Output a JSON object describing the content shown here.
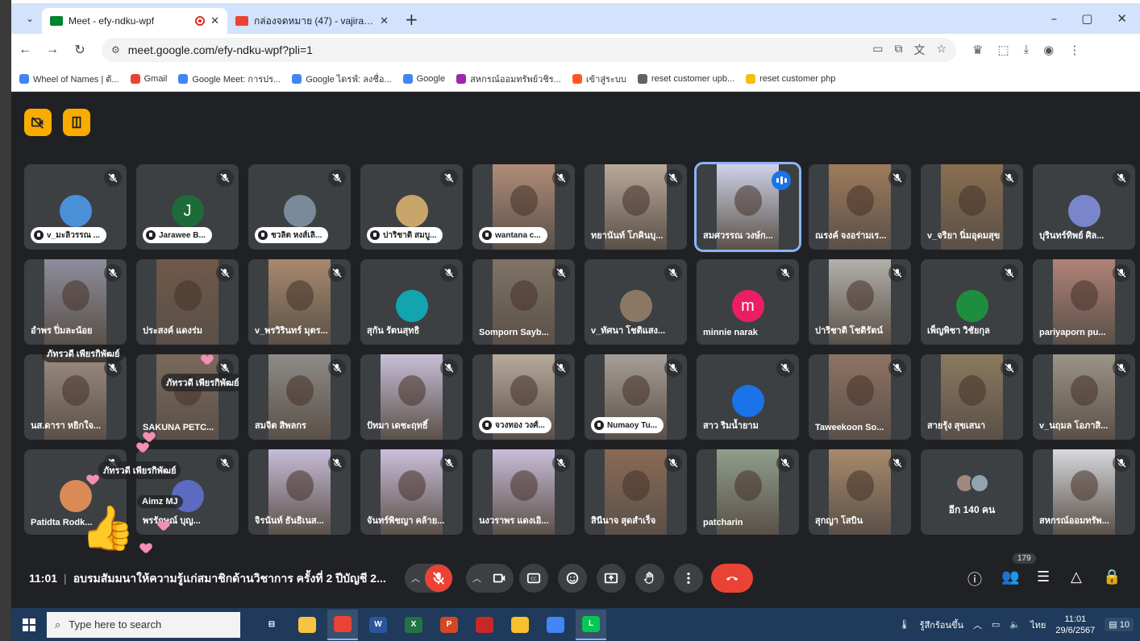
{
  "browser": {
    "tabs": [
      {
        "title": "Meet - efy-ndku-wpf",
        "favicon_color": "#00832d",
        "active": true
      },
      {
        "title": "กล่องจดหมาย (47) - vajiracoop@",
        "favicon_color": "#ea4335",
        "active": false
      }
    ],
    "url": "meet.google.com/efy-ndku-wpf?pli=1",
    "bookmarks": [
      {
        "label": "Wheel of Names | ตั...",
        "color": "#4285f4"
      },
      {
        "label": "Gmail",
        "color": "#ea4335"
      },
      {
        "label": "Google Meet: การปร...",
        "color": "#4285f4"
      },
      {
        "label": "Google ไดรฟ์: ลงชื่อ...",
        "color": "#4285f4"
      },
      {
        "label": "Google",
        "color": "#4285f4"
      },
      {
        "label": "สหกรณ์ออมทรัพย์วชิร...",
        "color": "#9c27b0"
      },
      {
        "label": "เข้าสู่ระบบ",
        "color": "#ff5722"
      },
      {
        "label": "reset customer upb...",
        "color": "#5f6368"
      },
      {
        "label": "reset customer php",
        "color": "#fbbc04"
      }
    ]
  },
  "participants": [
    {
      "name": "v_มะลิวรรณ ...",
      "kind": "avatar",
      "color": "#4a90d9",
      "initial": "",
      "pill": true
    },
    {
      "name": "Jarawee B...",
      "kind": "avatar",
      "color": "#1e6b3a",
      "initial": "J",
      "pill": true
    },
    {
      "name": "ชวลิต หงส์เลิ...",
      "kind": "avatar",
      "color": "#7a8a9a",
      "initial": "",
      "pill": true
    },
    {
      "name": "ปาริชาติ สมบู...",
      "kind": "avatar",
      "color": "#c8a66b",
      "initial": "",
      "pill": true
    },
    {
      "name": "wantana c...",
      "kind": "photo",
      "color": "#b08c78",
      "initial": "",
      "pill": true
    },
    {
      "name": "ทยานันท์ โภคินบุ...",
      "kind": "photo",
      "color": "#b9a99a",
      "initial": "",
      "pill": false
    },
    {
      "name": "สมศวรรณ วงษ์ก...",
      "kind": "photo",
      "color": "#cfd3e8",
      "initial": "",
      "pill": false
    },
    {
      "name": "ณรงค์ จงอร่ามเร...",
      "kind": "photo",
      "color": "#9f7b5c",
      "initial": "",
      "pill": false
    },
    {
      "name": "v_จริยา นิ่มอุดมสุข",
      "kind": "photo",
      "color": "#8a6e4f",
      "initial": "",
      "pill": false
    },
    {
      "name": "บุรินทร์ทิพย์ ศิล...",
      "kind": "avatar",
      "color": "#7986cb",
      "initial": "",
      "pill": false
    },
    {
      "name": "อำพร ปิ่มละน้อย",
      "kind": "photo",
      "color": "#8d8d9c",
      "initial": "",
      "pill": false
    },
    {
      "name": "ประสงค์ แดงร่ม",
      "kind": "photo",
      "color": "#6f5848",
      "initial": "",
      "pill": false
    },
    {
      "name": "v_พรวิรินทร์ มุตร...",
      "kind": "photo",
      "color": "#a88a6e",
      "initial": "",
      "pill": false
    },
    {
      "name": "สุกัน รัตนสุทธิ",
      "kind": "avatar",
      "color": "#12a4af",
      "initial": "",
      "pill": false
    },
    {
      "name": "Somporn Sayb...",
      "kind": "photo",
      "color": "#7f7466",
      "initial": "",
      "pill": false
    },
    {
      "name": "v_ทัศนา โชติแสง...",
      "kind": "avatar",
      "color": "#8a7865",
      "initial": "",
      "pill": false
    },
    {
      "name": "minnie narak",
      "kind": "avatar",
      "color": "#e91e63",
      "initial": "m",
      "pill": false
    },
    {
      "name": "ปาริชาติ โชติรัตน์",
      "kind": "photo",
      "color": "#b3b0ab",
      "initial": "",
      "pill": false
    },
    {
      "name": "เพ็ญพิชา วิชัยกุล",
      "kind": "avatar",
      "color": "#1e8e3e",
      "initial": "",
      "pill": false
    },
    {
      "name": "pariyaporn pu...",
      "kind": "photo",
      "color": "#b08277",
      "initial": "",
      "pill": false
    },
    {
      "name": "นส.ดารา หยิกใจ...",
      "kind": "photo",
      "color": "#9c8c80",
      "initial": "",
      "pill": false
    },
    {
      "name": "SAKUNA PETC...",
      "kind": "photo",
      "color": "#7a6a5d",
      "initial": "",
      "pill": false
    },
    {
      "name": "สมจิต สิพลกร",
      "kind": "photo",
      "color": "#8e8b87",
      "initial": "",
      "pill": false
    },
    {
      "name": "ปัทมา เดชะฤทธิ์",
      "kind": "photo",
      "color": "#c8bfd8",
      "initial": "",
      "pill": false
    },
    {
      "name": "จวงทอง วงศ์...",
      "kind": "photo",
      "color": "#b7a99c",
      "initial": "",
      "pill": true
    },
    {
      "name": "Numaoy Tu...",
      "kind": "photo",
      "color": "#a69f97",
      "initial": "",
      "pill": true
    },
    {
      "name": "สาว ริมน้ำยาม",
      "kind": "avatar",
      "color": "#1a73e8",
      "initial": "",
      "pill": false
    },
    {
      "name": "Taweekoon So...",
      "kind": "photo",
      "color": "#8f7363",
      "initial": "",
      "pill": false
    },
    {
      "name": "สายรุ้ง สุขเสนา",
      "kind": "photo",
      "color": "#8a7a5e",
      "initial": "",
      "pill": false
    },
    {
      "name": "v_นฤมล โอภาสิ...",
      "kind": "photo",
      "color": "#9c9487",
      "initial": "",
      "pill": false
    },
    {
      "name": "Patidta Rodk...",
      "kind": "avatar",
      "color": "#d98a56",
      "initial": "",
      "pill": false
    },
    {
      "name": "พรรักษณ์ บุญ...",
      "kind": "avatar",
      "color": "#5c6bc0",
      "initial": "",
      "pill": false
    },
    {
      "name": "จิรนันท์ ธันธิเนส...",
      "kind": "photo",
      "color": "#c7bcd9",
      "initial": "",
      "pill": false
    },
    {
      "name": "จันทร์พิชญา คล้าย...",
      "kind": "photo",
      "color": "#cbbfdc",
      "initial": "",
      "pill": false
    },
    {
      "name": "นงวราพร แดงเอิ...",
      "kind": "photo",
      "color": "#c9bdda",
      "initial": "",
      "pill": false
    },
    {
      "name": "สินีนาจ สุดสำเร็จ",
      "kind": "photo",
      "color": "#8a6a55",
      "initial": "",
      "pill": false
    },
    {
      "name": "patcharin",
      "kind": "photo",
      "color": "#8f9e8c",
      "initial": "",
      "pill": false
    },
    {
      "name": "สุกญา โสบิน",
      "kind": "photo",
      "color": "#a88a6c",
      "initial": "",
      "pill": false
    },
    {
      "name": "อีก 140 คน",
      "kind": "more",
      "color": "#3c4043",
      "initial": "",
      "pill": false
    },
    {
      "name": "สหกรณ์ออมทรัพ...",
      "kind": "photo",
      "color": "#d7d9dd",
      "initial": "",
      "pill": false
    }
  ],
  "reactions": {
    "sender_name": "ภัทรวดี เพียรกิพัฒย์",
    "second_name": "Aimz MJ"
  },
  "meeting": {
    "time": "11:01",
    "title": "อบรมสัมมนาให้ความรู้แก่สมาชิกด้านวิชาการ ครั้งที่ 2 ปีบัญชี 2...",
    "people_count": "179"
  },
  "taskbar": {
    "search_placeholder": "Type here to search",
    "weather": "รู้สึกร้อนขึ้น",
    "lang": "ไทย",
    "time": "11:01",
    "date": "29/6/2567",
    "notif": "10",
    "apps": [
      {
        "name": "task-view",
        "color": "#1f3a5a",
        "label": "⊟"
      },
      {
        "name": "file-explorer",
        "color": "#f6c342",
        "label": ""
      },
      {
        "name": "chrome",
        "color": "#ea4335",
        "label": ""
      },
      {
        "name": "word",
        "color": "#2b579a",
        "label": "W"
      },
      {
        "name": "excel",
        "color": "#217346",
        "label": "X"
      },
      {
        "name": "powerpoint",
        "color": "#d24726",
        "label": "P"
      },
      {
        "name": "app-red",
        "color": "#c62828",
        "label": ""
      },
      {
        "name": "sticky-notes",
        "color": "#fbc02d",
        "label": ""
      },
      {
        "name": "chrome-2",
        "color": "#4285f4",
        "label": ""
      },
      {
        "name": "line",
        "color": "#06c755",
        "label": "L"
      }
    ]
  }
}
